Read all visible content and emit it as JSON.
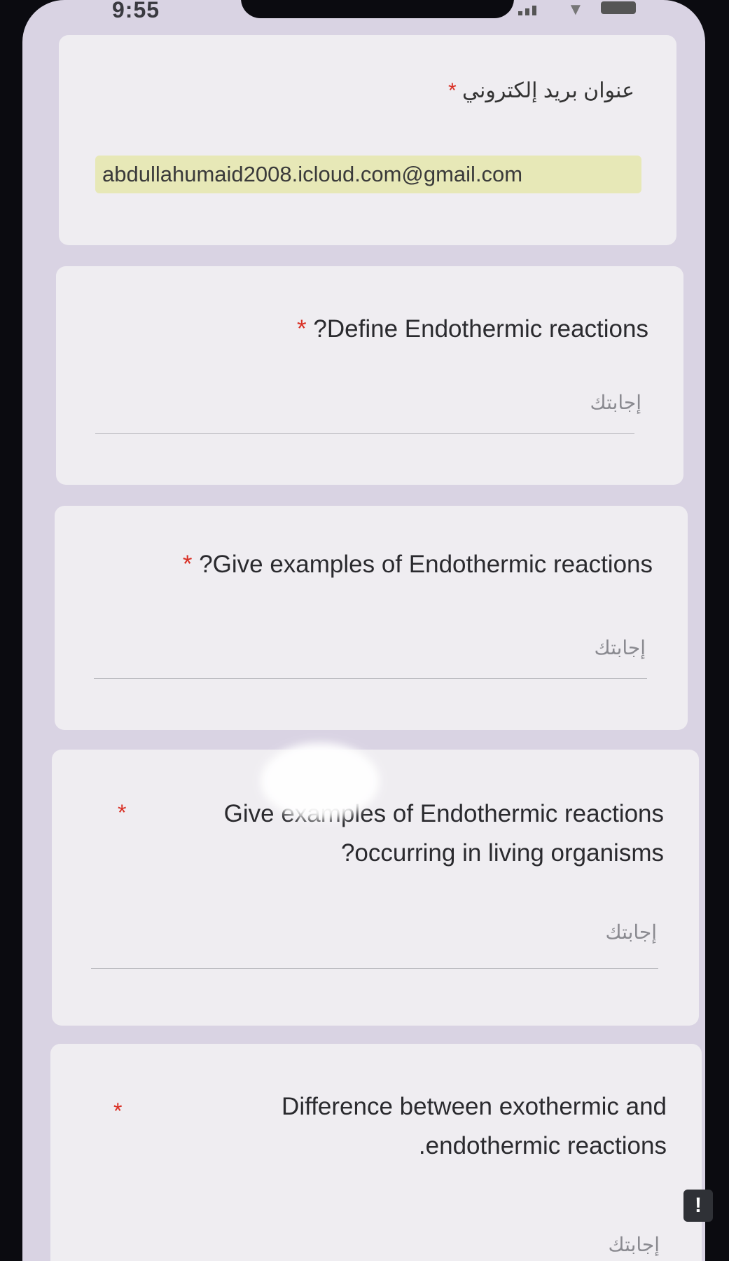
{
  "status_bar": {
    "time": "9:55"
  },
  "email_section": {
    "label": "عنوان بريد إلكتروني",
    "required_mark": "*",
    "value": "abdullahumaid2008.icloud.com@gmail.com"
  },
  "questions": [
    {
      "title": "?Define Endothermic reactions",
      "required_mark": "*",
      "answer_placeholder": "إجابتك"
    },
    {
      "title": "?Give examples of Endothermic reactions",
      "required_mark": "*",
      "answer_placeholder": "إجابتك"
    },
    {
      "title_line1": "Give examples of Endothermic reactions",
      "title_line2": "?occurring in living organisms",
      "required_mark": "*",
      "answer_placeholder": "إجابتك"
    },
    {
      "title_line1": "Difference between exothermic and",
      "title_line2": ".endothermic reactions",
      "required_mark": "*",
      "answer_placeholder": "إجابتك"
    }
  ],
  "report_button": {
    "label": "!"
  }
}
